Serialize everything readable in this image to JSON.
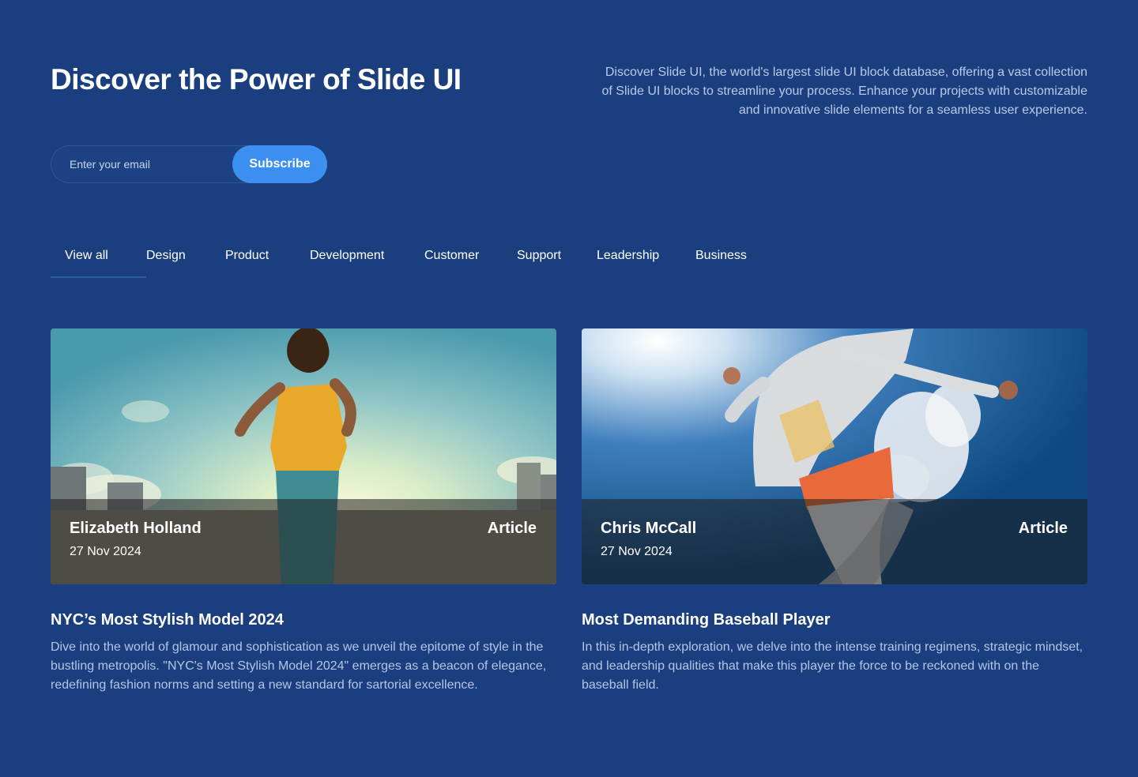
{
  "header": {
    "title": "Discover the Power of Slide UI",
    "description": "Discover Slide UI, the world's largest slide UI block database, offering a vast collection of Slide UI blocks to streamline your process. Enhance your projects with customizable and innovative slide elements for a seamless user experience."
  },
  "subscribe": {
    "placeholder": "Enter your email",
    "button_label": "Subscribe"
  },
  "tabs": [
    {
      "label": "View all",
      "active": true
    },
    {
      "label": "Design"
    },
    {
      "label": "Product"
    },
    {
      "label": "Development"
    },
    {
      "label": "Customer"
    },
    {
      "label": "Support"
    },
    {
      "label": "Leadership"
    },
    {
      "label": "Business"
    }
  ],
  "cards": [
    {
      "author": "Elizabeth Holland",
      "date": "27 Nov 2024",
      "category": "Article",
      "title": "NYC’s Most Stylish Model 2024",
      "description": "Dive into the world of glamour and sophistication as we unveil the epitome of style in the bustling metropolis. \"NYC's Most Stylish Model 2024\" emerges as a beacon of elegance, redefining fashion norms and setting a new standard for sartorial excellence."
    },
    {
      "author": "Chris McCall",
      "date": "27 Nov 2024",
      "category": "Article",
      "title": "Most Demanding Baseball Player",
      "description": "In this in-depth exploration, we delve into the intense training regimens, strategic mindset, and leadership qualities that make this player the force to be reckoned with on the baseball field."
    }
  ],
  "colors": {
    "background": "#1b3f7e",
    "accent": "#3b8ff0",
    "muted_text": "#b9c9ea"
  }
}
